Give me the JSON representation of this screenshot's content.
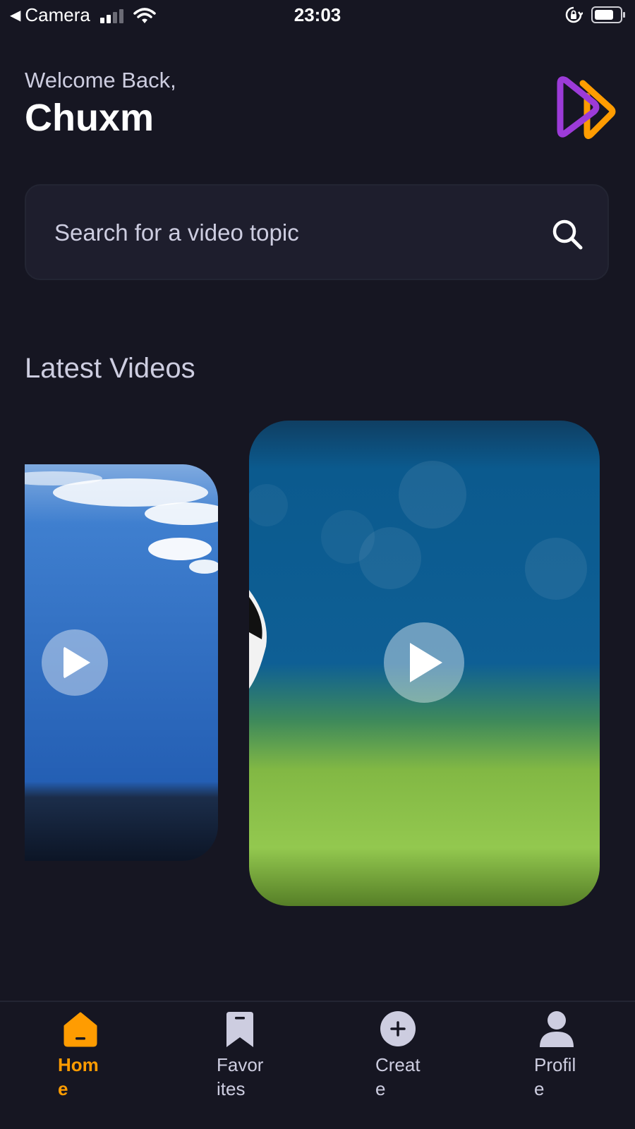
{
  "status_bar": {
    "back_app": "Camera",
    "time": "23:03",
    "signal_bars_on": 2,
    "signal_bars_total": 4,
    "battery_level": 0.75,
    "icons": [
      "back-arrow-icon",
      "signal-icon",
      "wifi-icon",
      "rotation-lock-icon",
      "battery-icon"
    ]
  },
  "header": {
    "welcome": "Welcome Back,",
    "username": "Chuxm",
    "logo_icon": "app-logo-icon"
  },
  "search": {
    "placeholder": "Search for a video topic",
    "value": "",
    "icon": "search-icon"
  },
  "latest": {
    "title": "Latest Videos",
    "videos": [
      {
        "thumbnail": "aerial ocean and clouds",
        "play_icon": "play-icon"
      },
      {
        "thumbnail": "blue and green blurred scene",
        "play_icon": "play-icon"
      }
    ]
  },
  "tabs": [
    {
      "label": "Home",
      "icon": "home-icon",
      "active": true
    },
    {
      "label": "Favorites",
      "icon": "bookmark-icon",
      "active": false
    },
    {
      "label": "Create",
      "icon": "plus-circle-icon",
      "active": false
    },
    {
      "label": "Profile",
      "icon": "profile-icon",
      "active": false
    }
  ],
  "colors": {
    "background": "#161622",
    "search_background": "#1E1E2D",
    "accent": "#FF9C01",
    "muted_text": "#CDCDE0",
    "logo_purple": "#9C3BD8"
  }
}
